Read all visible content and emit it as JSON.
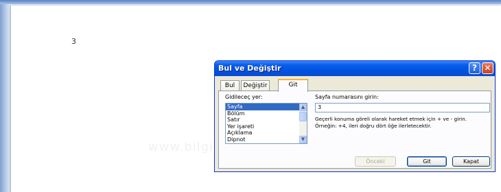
{
  "document": {
    "page_text": "3",
    "watermark": "www.bilgisayardershanesi.com"
  },
  "dialog": {
    "title": "Bul ve Değiştir",
    "help_button": "?",
    "close_button": "✕",
    "tabs": [
      {
        "label": "Bul"
      },
      {
        "label": "Değiştir"
      },
      {
        "label": "Git"
      }
    ],
    "active_tab": "Git",
    "goto_label": "Gidileceç yer:",
    "goto_items": [
      "Sayfa",
      "Bölüm",
      "Satır",
      "Yer işareti",
      "Açıklama",
      "Dipnot"
    ],
    "selected_item": "Sayfa",
    "page_number_label": "Sayfa numarasını girin:",
    "page_number_value": "3",
    "hint_text": "Geçerli konuma göreli olarak hareket etmek için + ve - girin. Örneğin: +4, ileri doğru dört öğe ilerletecektir.",
    "buttons": {
      "previous": "Önceki",
      "goto": "Git",
      "close": "Kapat"
    }
  },
  "colors": {
    "titlebar": "#0a5fe8",
    "dialog_bg": "#ece9d8",
    "selection": "#316ac5",
    "active_tab_accent": "#f8b334"
  }
}
